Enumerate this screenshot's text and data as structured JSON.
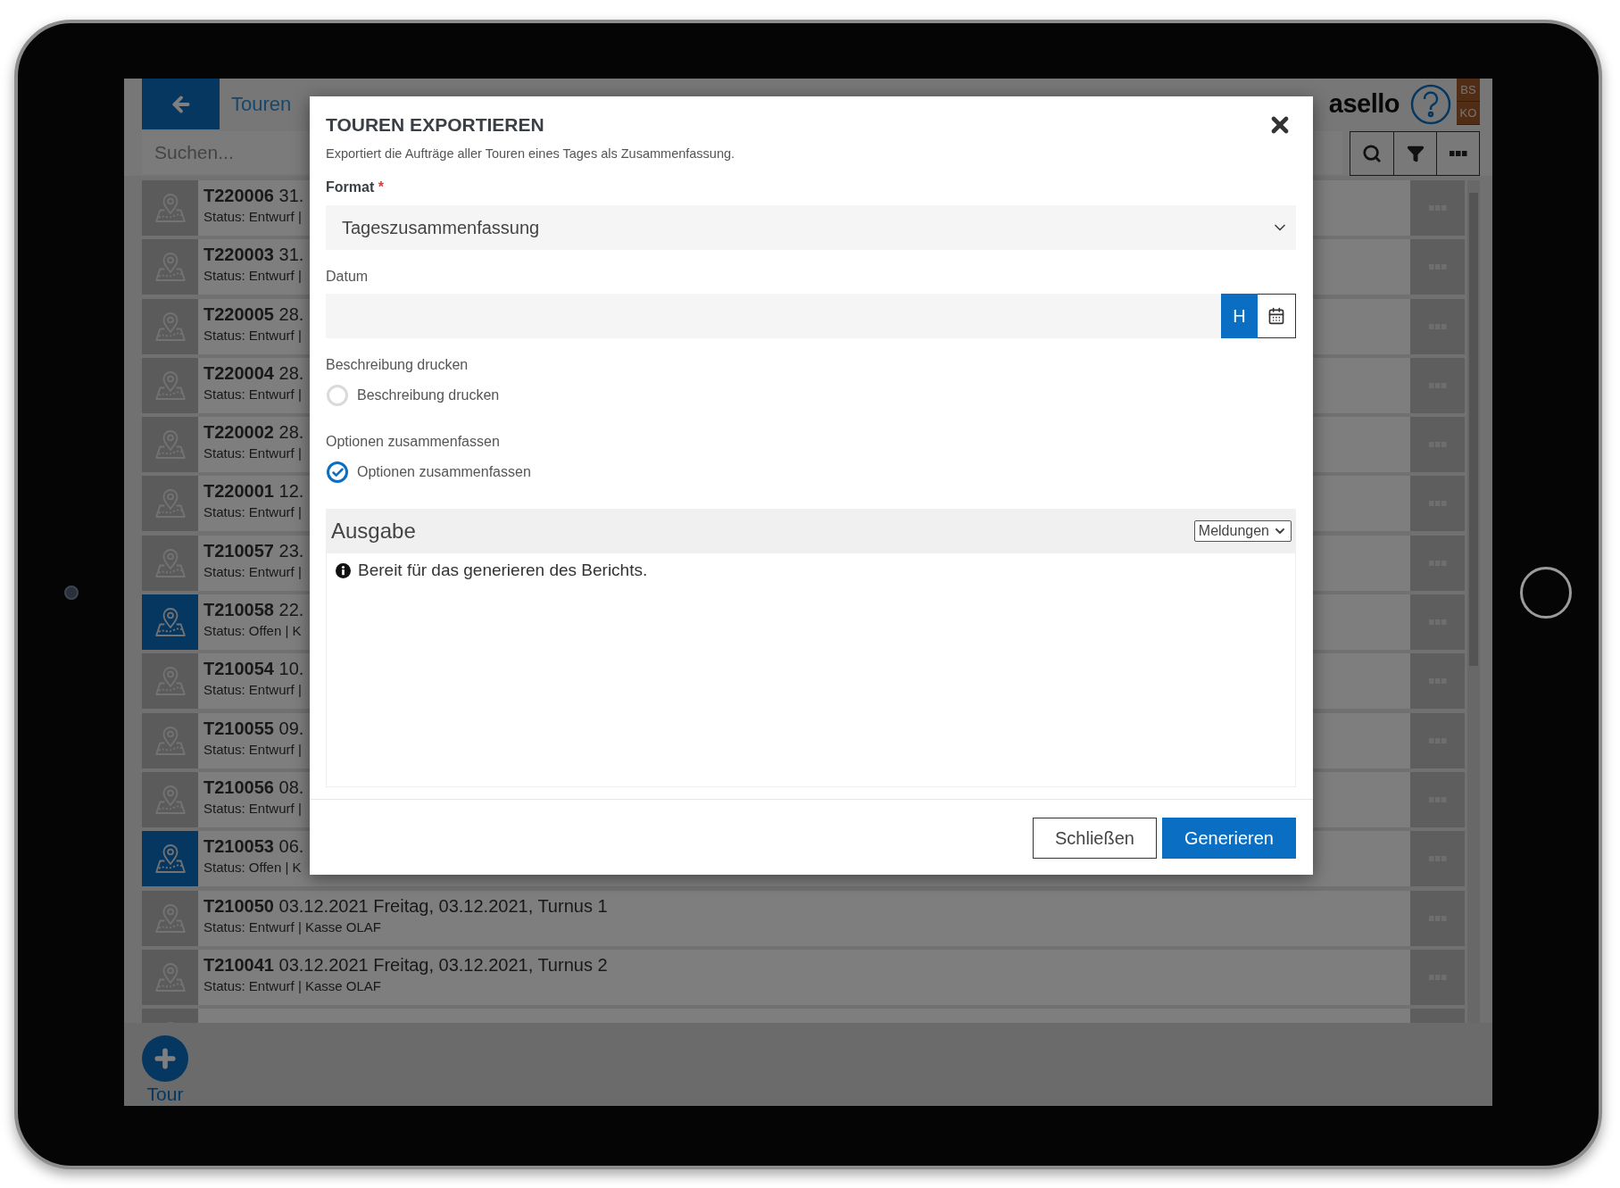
{
  "header": {
    "title": "Touren",
    "logo": "asello",
    "user_badges": [
      "BS",
      "KO"
    ]
  },
  "search": {
    "placeholder": "Suchen..."
  },
  "tours": [
    {
      "id": "T220006",
      "date": "31.",
      "status": "Status: Entwurf |",
      "highlighted": false
    },
    {
      "id": "T220003",
      "date": "31.",
      "status": "Status: Entwurf |",
      "highlighted": false
    },
    {
      "id": "T220005",
      "date": "28.",
      "status": "Status: Entwurf |",
      "highlighted": false
    },
    {
      "id": "T220004",
      "date": "28.",
      "status": "Status: Entwurf |",
      "highlighted": false
    },
    {
      "id": "T220002",
      "date": "28.",
      "status": "Status: Entwurf |",
      "highlighted": false
    },
    {
      "id": "T220001",
      "date": "12.",
      "status": "Status: Entwurf |",
      "highlighted": false
    },
    {
      "id": "T210057",
      "date": "23.",
      "status": "Status: Entwurf |",
      "highlighted": false
    },
    {
      "id": "T210058",
      "date": "22.",
      "status": "Status: Offen | K",
      "highlighted": true
    },
    {
      "id": "T210054",
      "date": "10.",
      "status": "Status: Entwurf |",
      "highlighted": false
    },
    {
      "id": "T210055",
      "date": "09.",
      "status": "Status: Entwurf |",
      "highlighted": false
    },
    {
      "id": "T210056",
      "date": "08.",
      "status": "Status: Entwurf |",
      "highlighted": false
    },
    {
      "id": "T210053",
      "date": "06.",
      "status": "Status: Offen | K",
      "highlighted": true
    },
    {
      "id": "T210050",
      "date": "03.12.2021 Freitag, 03.12.2021, Turnus 1",
      "status": "Status: Entwurf | Kasse OLAF",
      "highlighted": false
    },
    {
      "id": "T210041",
      "date": "03.12.2021 Freitag, 03.12.2021, Turnus 2",
      "status": "Status: Entwurf | Kasse OLAF",
      "highlighted": false
    },
    {
      "highlighted": false
    }
  ],
  "add_button": {
    "label": "Tour"
  },
  "dialog": {
    "title": "TOUREN EXPORTIEREN",
    "description": "Exportiert die Aufträge aller Touren eines Tages als Zusammenfassung.",
    "format": {
      "label": "Format",
      "required_mark": "*",
      "value": "Tageszusammenfassung"
    },
    "date": {
      "label": "Datum",
      "today_button": "H"
    },
    "options": [
      {
        "label": "Beschreibung drucken",
        "option": "Beschreibung drucken",
        "checked": false
      },
      {
        "label": "Optionen zusammenfassen",
        "option": "Optionen zusammenfassen",
        "checked": true
      }
    ],
    "output": {
      "title": "Ausgabe",
      "filter": "Meldungen",
      "messages": [
        {
          "text": "Bereit für das generieren des Berichts."
        }
      ]
    },
    "buttons": [
      {
        "label": "Schließen",
        "kind": "secondary"
      },
      {
        "label": "Generieren",
        "kind": "primary"
      }
    ]
  }
}
